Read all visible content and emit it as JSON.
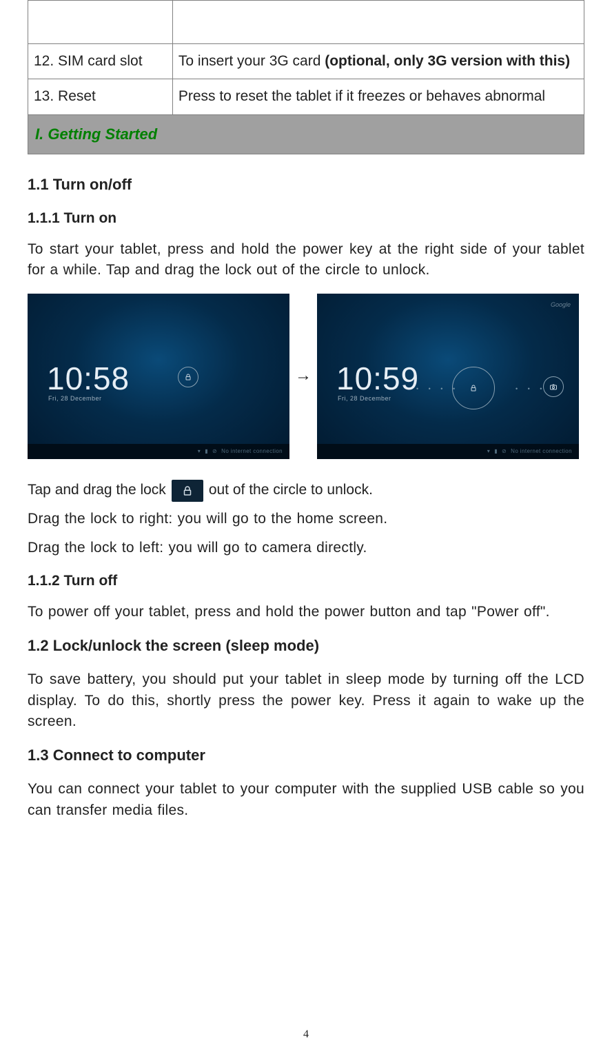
{
  "table": {
    "rows": [
      {
        "left": "12.  SIM card slot",
        "right_pre": "To insert your 3G card ",
        "right_bold": "(optional, only 3G version with this)"
      },
      {
        "left": "13.  Reset",
        "right_pre": "Press to reset the tablet if it freezes or behaves abnormal",
        "right_bold": ""
      }
    ]
  },
  "section_title": "I. Getting Started",
  "h_1_1": "1.1 Turn on/off",
  "h_1_1_1": "1.1.1 Turn on",
  "p_turn_on": "To start your tablet, press and hold the power key at the right side of your tablet for a while. Tap and drag the lock out of the circle to unlock.",
  "arrow": "→",
  "lockscreens": {
    "left": {
      "time": "10:58",
      "date": "Fri, 28 December",
      "status": "No internet connection"
    },
    "right": {
      "time": "10:59",
      "date": "Fri, 28 December",
      "google": "Google",
      "status": "No internet connection"
    }
  },
  "inline_pre": "Tap and drag the lock ",
  "inline_post": " out of the circle to unlock.",
  "line_drag_right": "Drag the lock to right: you will go to the home screen.",
  "line_drag_left": "Drag the lock to left: you will go to camera directly.",
  "h_1_1_2": "1.1.2 Turn off",
  "p_turn_off": "To power off your tablet, press and hold the power button and tap \"Power off\".",
  "h_1_2": "1.2 Lock/unlock the screen (sleep mode)",
  "p_sleep": "To save battery, you should put your tablet in sleep mode by turning off the LCD display. To do this, shortly press the power key. Press it again to wake up the screen.",
  "h_1_3": "1.3 Connect to computer",
  "p_connect": "You can connect your tablet to your computer with the supplied USB cable so you can transfer media files.",
  "page_number": "4"
}
